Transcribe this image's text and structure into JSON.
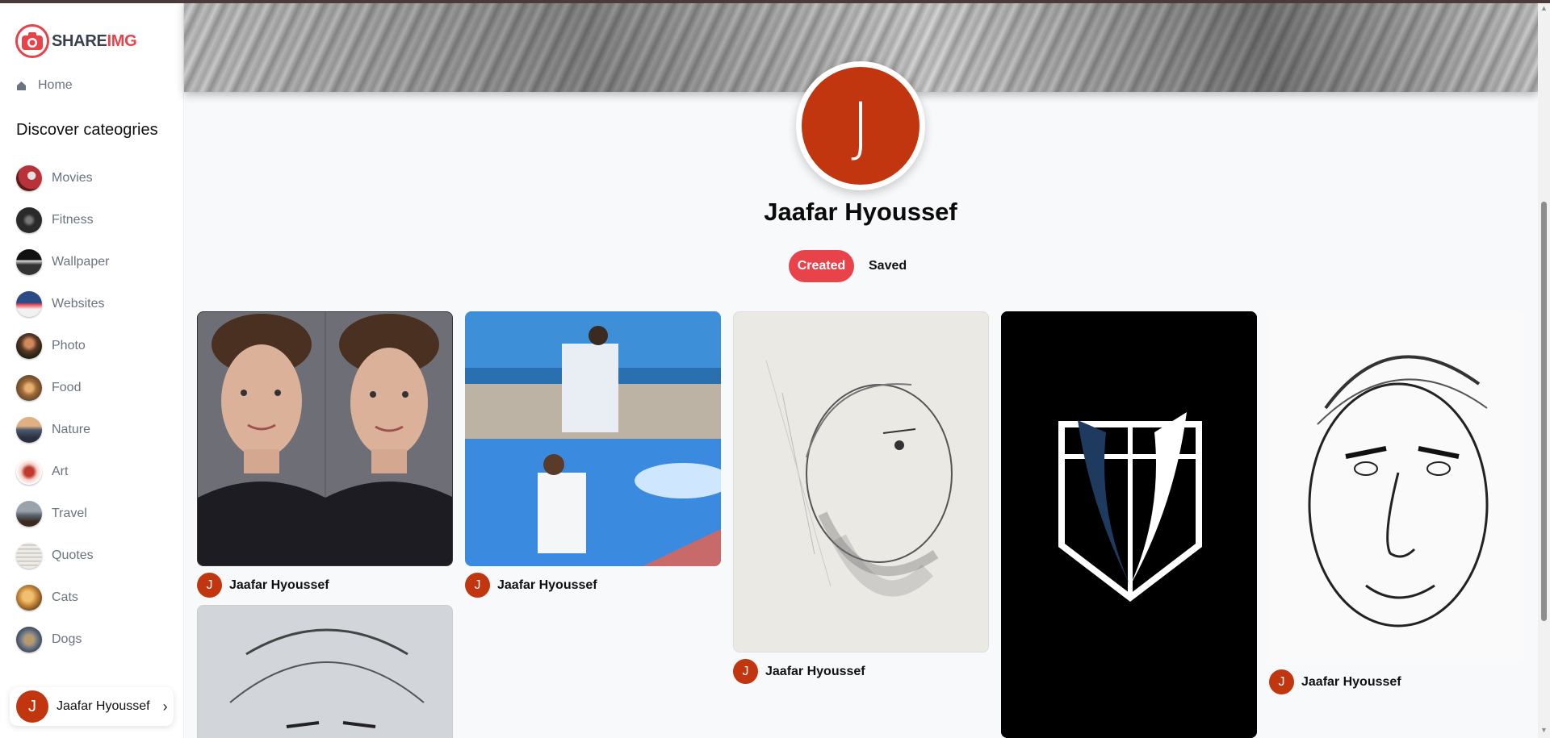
{
  "app": {
    "logo_share": "SHARE",
    "logo_img": "IMG",
    "brand_color": "#e8434a"
  },
  "sidebar": {
    "home_label": "Home",
    "discover_title": "Discover cateogries",
    "categories": [
      {
        "label": "Movies",
        "color": "#b8323a"
      },
      {
        "label": "Fitness",
        "color": "#2a2a2a"
      },
      {
        "label": "Wallpaper",
        "color": "#1f2937"
      },
      {
        "label": "Websites",
        "color": "#2c4a86"
      },
      {
        "label": "Photo",
        "color": "#5a3828"
      },
      {
        "label": "Food",
        "color": "#a06a3a"
      },
      {
        "label": "Nature",
        "color": "#4a5a70"
      },
      {
        "label": "Art",
        "color": "#d36a5a"
      },
      {
        "label": "Travel",
        "color": "#5c6470"
      },
      {
        "label": "Quotes",
        "color": "#d8d4cc"
      },
      {
        "label": "Cats",
        "color": "#c98a3a"
      },
      {
        "label": "Dogs",
        "color": "#6e7a8a"
      }
    ],
    "user": {
      "initial": "J",
      "name": "Jaafar Hyoussef",
      "chevron": "›"
    }
  },
  "profile": {
    "initial": "J",
    "name": "Jaafar Hyoussef",
    "avatar_color": "#c2360f",
    "tabs": {
      "created": "Created",
      "saved": "Saved"
    }
  },
  "pins": [
    {
      "author": "Jaafar Hyoussef",
      "initial": "J"
    },
    {
      "author": "Jaafar Hyoussef",
      "initial": "J"
    },
    {
      "author": "Jaafar Hyoussef",
      "initial": "J"
    },
    {
      "author": "Jaafar Hyoussef",
      "initial": "J"
    }
  ]
}
